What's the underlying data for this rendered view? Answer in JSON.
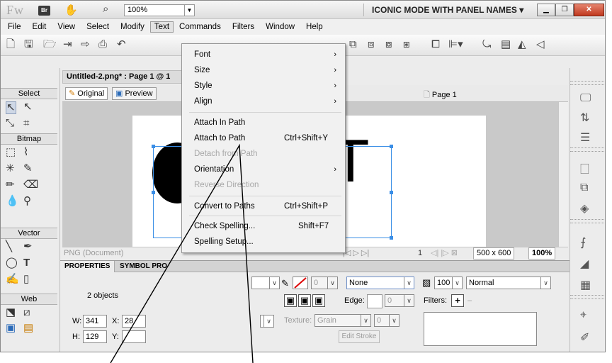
{
  "titlebar": {
    "logo": "Fw",
    "br_label": "Br",
    "zoom": "100%",
    "mode": "ICONIC MODE WITH PANEL NAMES"
  },
  "menubar": [
    "File",
    "Edit",
    "View",
    "Select",
    "Modify",
    "Text",
    "Commands",
    "Filters",
    "Window",
    "Help"
  ],
  "document": {
    "tab_title": "Untitled-2.png* : Page 1 @ 1",
    "views": [
      "Original",
      "Preview"
    ],
    "page": "Page 1",
    "canvas_text": "XT",
    "status_doc": "PNG (Document)",
    "frame_num": "1",
    "size": "500 x 600",
    "zoom": "100%"
  },
  "left_tools": {
    "select": "Select",
    "bitmap": "Bitmap",
    "vector": "Vector",
    "web": "Web"
  },
  "properties": {
    "tabs": [
      "PROPERTIES",
      "SYMBOL PRO"
    ],
    "summary": "2 objects",
    "w_label": "W:",
    "w_value": "341",
    "x_label": "X:",
    "x_value": "28",
    "h_label": "H:",
    "h_value": "129",
    "y_label": "Y:",
    "stroke_size": "0",
    "stroke_type": "None",
    "edge_label": "Edge:",
    "edge_value": "0",
    "texture_label": "Texture:",
    "texture_value": "Grain",
    "texture_amount": "0",
    "edit_stroke": "Edit Stroke",
    "opacity": "100",
    "blend": "Normal",
    "filters_label": "Filters:"
  },
  "text_menu": {
    "items": [
      {
        "label": "Font",
        "submenu": true
      },
      {
        "label": "Size",
        "submenu": true
      },
      {
        "label": "Style",
        "submenu": true
      },
      {
        "label": "Align",
        "submenu": true
      },
      {
        "label": "Attach In Path"
      },
      {
        "label": "Attach to Path",
        "shortcut": "Ctrl+Shift+Y"
      },
      {
        "label": "Detach from Path",
        "disabled": true
      },
      {
        "label": "Orientation",
        "submenu": true
      },
      {
        "label": "Reverse Direction",
        "disabled": true
      },
      {
        "label": "Convert to Paths",
        "shortcut": "Ctrl+Shift+P"
      },
      {
        "label": "Check Spelling...",
        "shortcut": "Shift+F7"
      },
      {
        "label": "Spelling Setup..."
      }
    ]
  }
}
